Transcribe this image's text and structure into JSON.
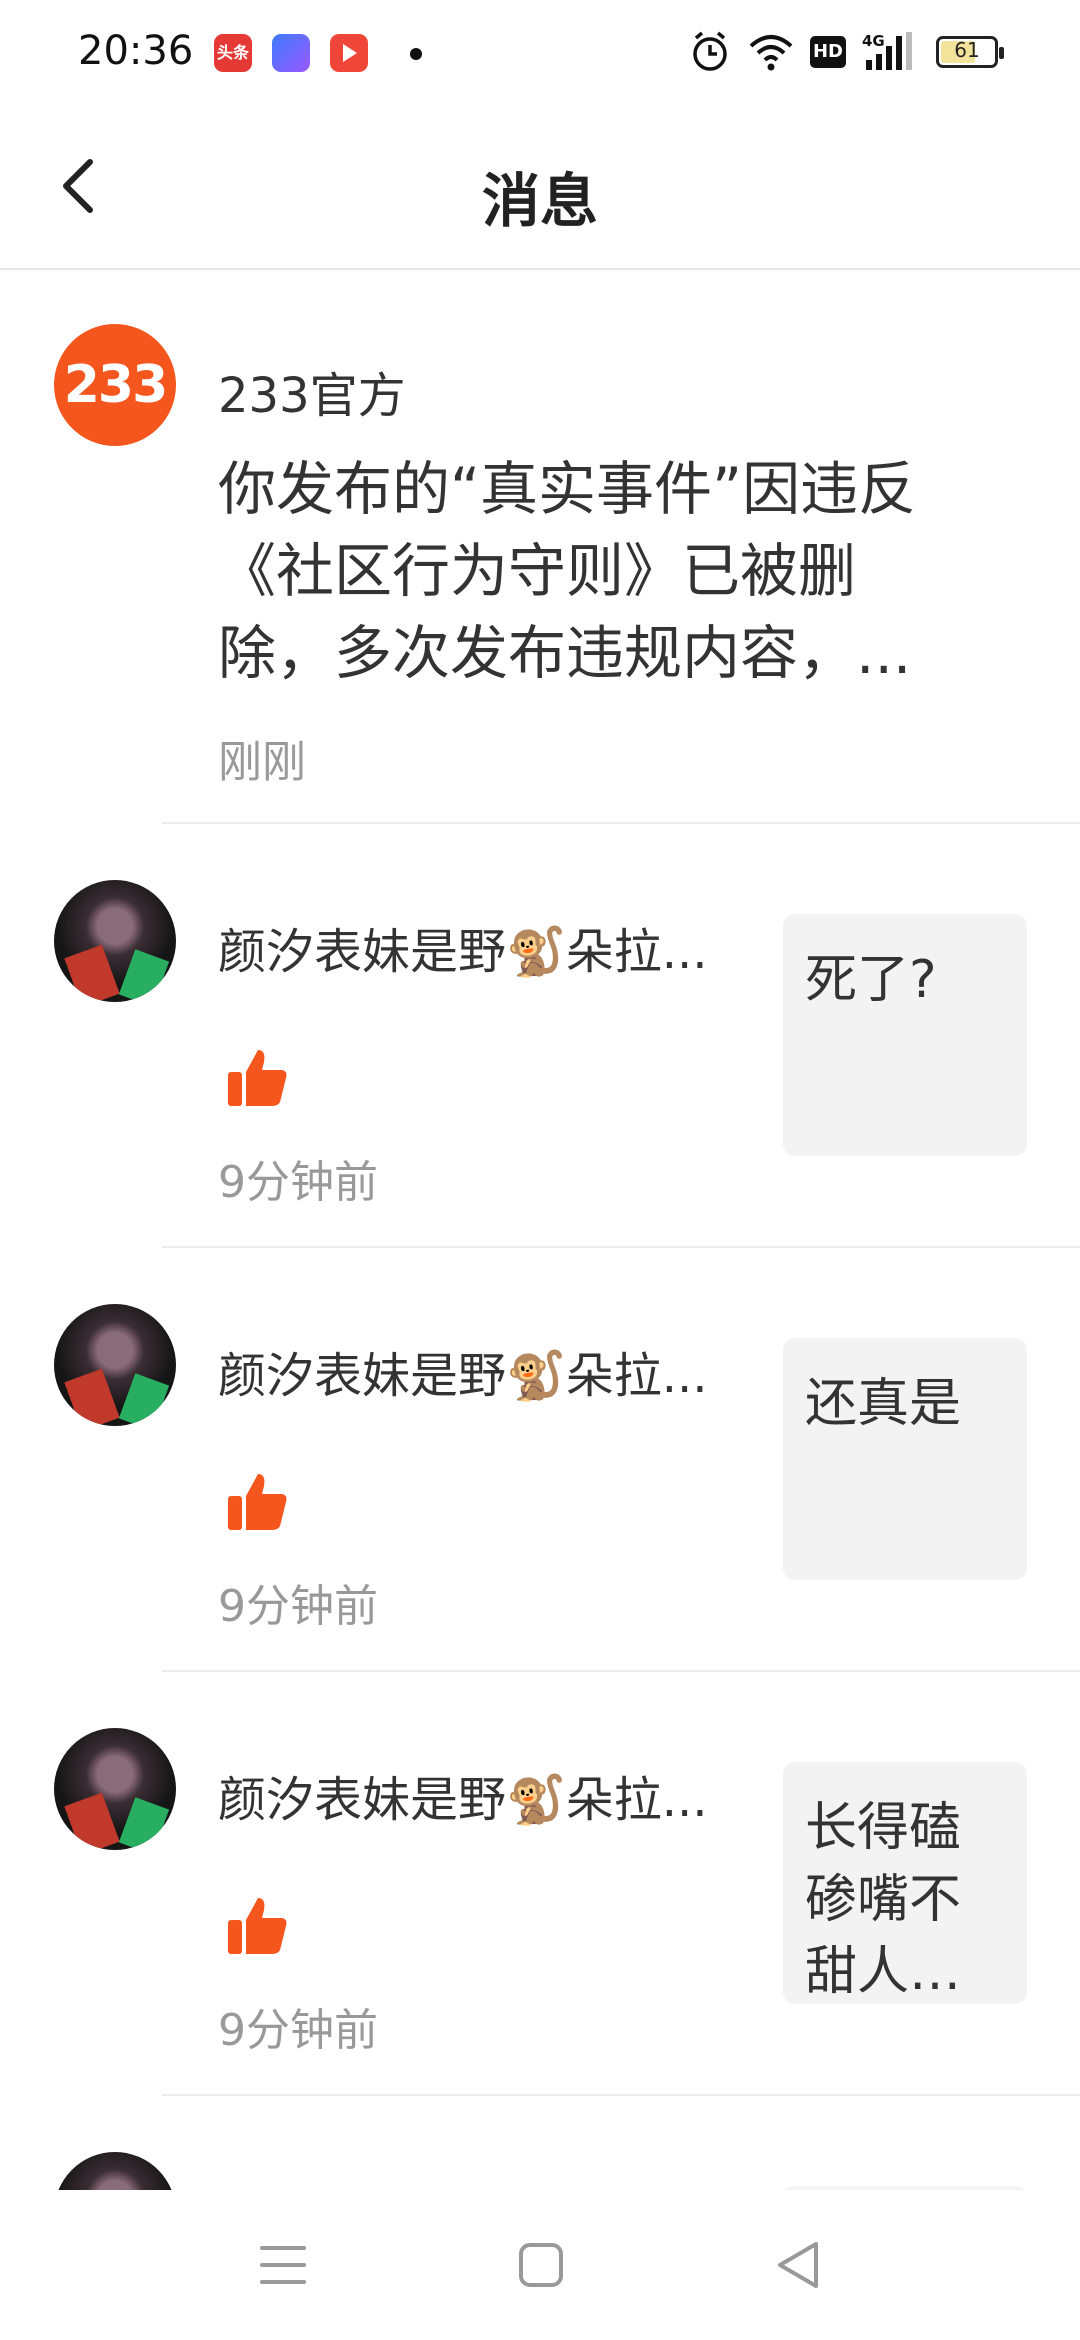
{
  "status": {
    "time": "20:36",
    "app1_label": "头条",
    "hd": "HD",
    "battery": "61"
  },
  "header": {
    "title": "消息"
  },
  "official": {
    "avatar_text": "233",
    "name": "233官方",
    "message": "你发布的“真实事件”因违反《社区行为守则》已被删除，多次发布违规内容，...",
    "time": "刚刚"
  },
  "notifications": [
    {
      "name": "颜汐表妹是野🐒朵拉...",
      "time": "9分钟前",
      "quote": "死了?"
    },
    {
      "name": "颜汐表妹是野🐒朵拉...",
      "time": "9分钟前",
      "quote": "还真是"
    },
    {
      "name": "颜汐表妹是野🐒朵拉...",
      "time": "9分钟前",
      "quote": "长得磕碜嘴不甜人不..."
    }
  ],
  "colors": {
    "accent": "#f5561e",
    "like": "#f5561e",
    "quote_bg": "#f3f3f3"
  }
}
